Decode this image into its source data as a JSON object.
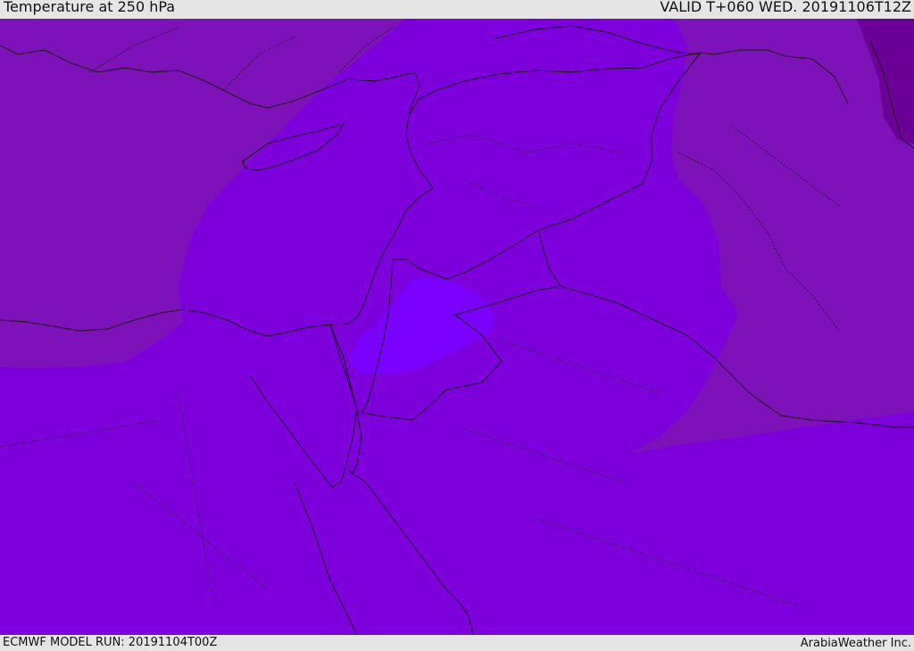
{
  "header": {
    "title": "Temperature at 250 hPa",
    "valid_time": "VALID T+060 WED. 20191106T12Z"
  },
  "footer": {
    "model_run": "ECMWF MODEL RUN: 20191104T00Z",
    "credit": "ArabiaWeather Inc."
  },
  "colors": {
    "background_zone": "#7d00dc",
    "warm_zone": "#7c12b8",
    "cold_core": "#7a00ff",
    "north_east_dark": "#6a0096",
    "coastline": "#111111",
    "border": "#111111"
  }
}
